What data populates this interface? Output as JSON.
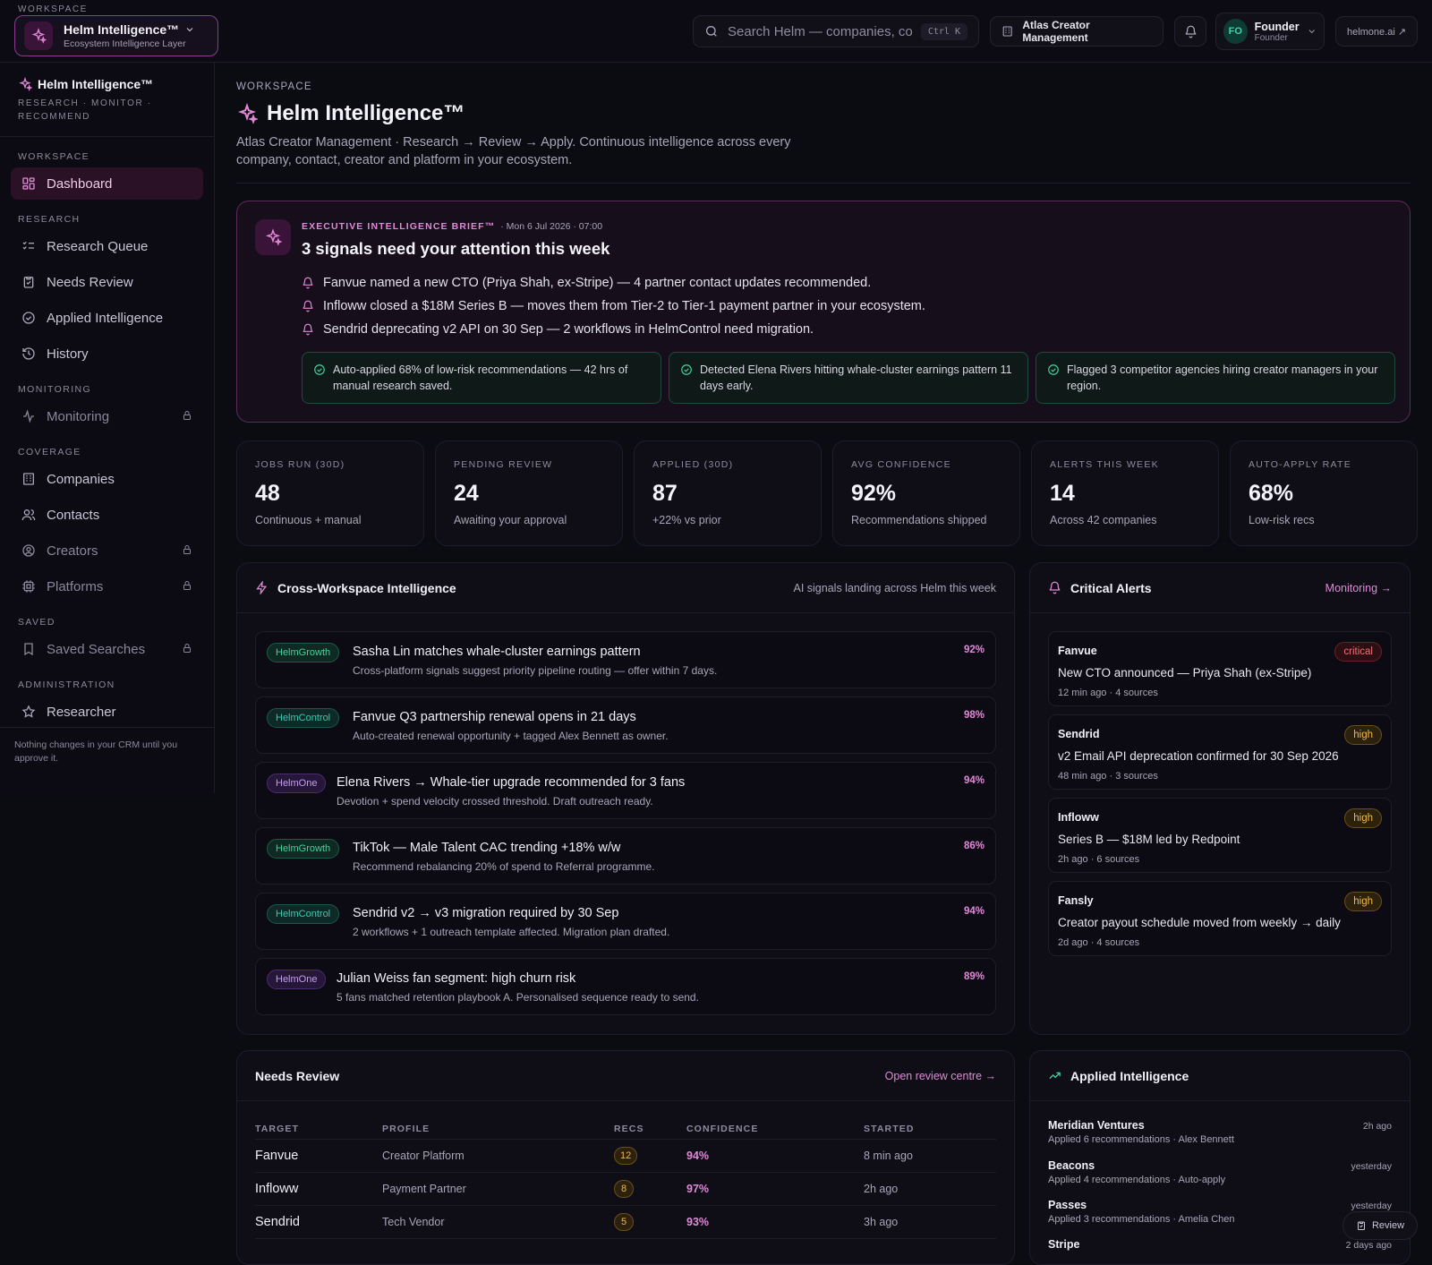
{
  "topbar": {
    "workspace_label": "WORKSPACE",
    "workspace_name": "Helm Intelligence™",
    "workspace_sub": "Ecosystem Intelligence Layer",
    "search_placeholder": "Search Helm — companies, co...",
    "search_shortcut": "Ctrl K",
    "org_name": "Atlas Creator Management",
    "user_initials": "FO",
    "user_name": "Founder",
    "user_role": "Founder",
    "site_link": "helmone.ai ↗"
  },
  "sidebar": {
    "brand_title": "Helm Intelligence™",
    "brand_sub": "RESEARCH · MONITOR · RECOMMEND",
    "sections": {
      "workspace": "WORKSPACE",
      "research": "RESEARCH",
      "monitoring": "MONITORING",
      "coverage": "COVERAGE",
      "saved": "SAVED",
      "administration": "ADMINISTRATION"
    },
    "items": {
      "dashboard": "Dashboard",
      "research_queue": "Research Queue",
      "needs_review": "Needs Review",
      "applied_intelligence": "Applied Intelligence",
      "history": "History",
      "monitoring": "Monitoring",
      "companies": "Companies",
      "contacts": "Contacts",
      "creators": "Creators",
      "platforms": "Platforms",
      "saved_searches": "Saved Searches",
      "researcher": "Researcher"
    },
    "footer": "Nothing changes in your CRM until you approve it."
  },
  "header": {
    "breadcrumb": "WORKSPACE",
    "title": "Helm Intelligence™",
    "description": "Atlas Creator Management · Research → Review → Apply. Continuous intelligence across every company, contact, creator and platform in your ecosystem."
  },
  "brief": {
    "label": "EXECUTIVE INTELLIGENCE BRIEF™",
    "date": "· Mon 6 Jul 2026 · 07:00",
    "title": "3 signals need your attention this week",
    "items": [
      "Fanvue named a new CTO (Priya Shah, ex-Stripe) — 4 partner contact updates recommended.",
      "Infloww closed a $18M Series B — moves them from Tier-2 to Tier-1 payment partner in your ecosystem.",
      "Sendrid deprecating v2 API on 30 Sep — 2 workflows in HelmControl need migration."
    ],
    "cards": [
      "Auto-applied 68% of low-risk recommendations — 42 hrs of manual research saved.",
      "Detected Elena Rivers hitting whale-cluster earnings pattern 11 days early.",
      "Flagged 3 competitor agencies hiring creator managers in your region."
    ]
  },
  "kpis": [
    {
      "label": "JOBS RUN (30D)",
      "value": "48",
      "sub": "Continuous + manual"
    },
    {
      "label": "PENDING REVIEW",
      "value": "24",
      "sub": "Awaiting your approval"
    },
    {
      "label": "APPLIED (30D)",
      "value": "87",
      "sub": "+22% vs prior"
    },
    {
      "label": "AVG CONFIDENCE",
      "value": "92%",
      "sub": "Recommendations shipped"
    },
    {
      "label": "ALERTS THIS WEEK",
      "value": "14",
      "sub": "Across 42 companies"
    },
    {
      "label": "AUTO-APPLY RATE",
      "value": "68%",
      "sub": "Low-risk recs"
    }
  ],
  "cross": {
    "title": "Cross-Workspace Intelligence",
    "meta": "AI signals landing across Helm this week",
    "items": [
      {
        "tag": "HelmGrowth",
        "title": "Sasha Lin matches whale-cluster earnings pattern",
        "desc": "Cross-platform signals suggest priority pipeline routing — offer within 7 days.",
        "pct": "92%"
      },
      {
        "tag": "HelmControl",
        "title": "Fanvue Q3 partnership renewal opens in 21 days",
        "desc": "Auto-created renewal opportunity + tagged Alex Bennett as owner.",
        "pct": "98%"
      },
      {
        "tag": "HelmOne",
        "title": "Elena Rivers → Whale-tier upgrade recommended for 3 fans",
        "desc": "Devotion + spend velocity crossed threshold. Draft outreach ready.",
        "pct": "94%"
      },
      {
        "tag": "HelmGrowth",
        "title": "TikTok — Male Talent CAC trending +18% w/w",
        "desc": "Recommend rebalancing 20% of spend to Referral programme.",
        "pct": "86%"
      },
      {
        "tag": "HelmControl",
        "title": "Sendrid v2 → v3 migration required by 30 Sep",
        "desc": "2 workflows + 1 outreach template affected. Migration plan drafted.",
        "pct": "94%"
      },
      {
        "tag": "HelmOne",
        "title": "Julian Weiss fan segment: high churn risk",
        "desc": "5 fans matched retention playbook A. Personalised sequence ready to send.",
        "pct": "89%"
      }
    ]
  },
  "alerts": {
    "title": "Critical Alerts",
    "link": "Monitoring →",
    "items": [
      {
        "company": "Fanvue",
        "severity": "critical",
        "title": "New CTO announced — Priya Shah (ex-Stripe)",
        "meta": "12 min ago · 4 sources"
      },
      {
        "company": "Sendrid",
        "severity": "high",
        "title": "v2 Email API deprecation confirmed for 30 Sep 2026",
        "meta": "48 min ago · 3 sources"
      },
      {
        "company": "Infloww",
        "severity": "high",
        "title": "Series B — $18M led by Redpoint",
        "meta": "2h ago · 6 sources"
      },
      {
        "company": "Fansly",
        "severity": "high",
        "title": "Creator payout schedule moved from weekly → daily",
        "meta": "2d ago · 4 sources"
      }
    ]
  },
  "review": {
    "title": "Needs Review",
    "link": "Open review centre →",
    "columns": [
      "TARGET",
      "PROFILE",
      "RECS",
      "CONFIDENCE",
      "STARTED"
    ],
    "rows": [
      {
        "target": "Fanvue",
        "profile": "Creator Platform",
        "recs": "12",
        "confidence": "94%",
        "started": "8 min ago"
      },
      {
        "target": "Infloww",
        "profile": "Payment Partner",
        "recs": "8",
        "confidence": "97%",
        "started": "2h ago"
      },
      {
        "target": "Sendrid",
        "profile": "Tech Vendor",
        "recs": "5",
        "confidence": "93%",
        "started": "3h ago"
      }
    ]
  },
  "applied": {
    "title": "Applied Intelligence",
    "items": [
      {
        "name": "Meridian Ventures",
        "desc": "Applied 6 recommendations · Alex Bennett",
        "time": "2h ago"
      },
      {
        "name": "Beacons",
        "desc": "Applied 4 recommendations · Auto-apply",
        "time": "yesterday"
      },
      {
        "name": "Passes",
        "desc": "Applied 3 recommendations · Amelia Chen",
        "time": "yesterday"
      },
      {
        "name": "Stripe",
        "desc": "",
        "time": "2 days ago"
      }
    ]
  },
  "fab": {
    "label": "Review"
  }
}
